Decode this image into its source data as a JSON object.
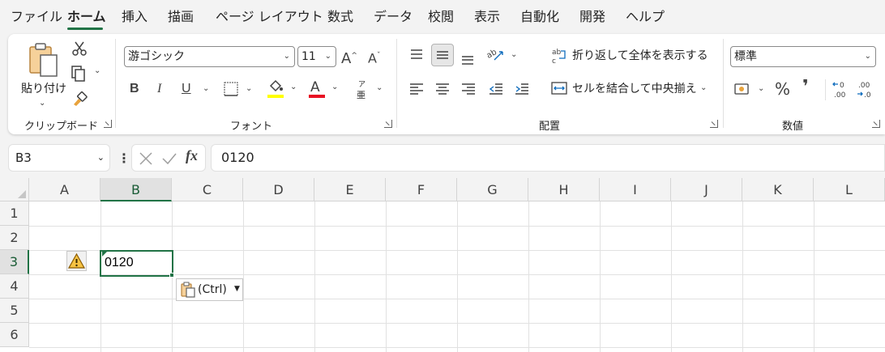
{
  "menu": {
    "tabs": [
      "ファイル",
      "ホーム",
      "挿入",
      "描画",
      "ページ レイアウト",
      "数式",
      "データ",
      "校閲",
      "表示",
      "自動化",
      "開発",
      "ヘルプ"
    ],
    "active_tab": "ホーム"
  },
  "ribbon": {
    "clipboard": {
      "paste_label": "貼り付け",
      "group_label": "クリップボード"
    },
    "font": {
      "font_name": "游ゴシック",
      "font_size": "11",
      "group_label": "フォント",
      "bold": "B",
      "italic": "I",
      "underline": "U",
      "phonetic_top": "ア",
      "phonetic_bottom": "亜"
    },
    "alignment": {
      "wrap_text": "折り返して全体を表示する",
      "merge_center": "セルを結合して中央揃え",
      "group_label": "配置"
    },
    "number": {
      "format": "標準",
      "percent": "%",
      "comma": "❜",
      "group_label": "数値"
    }
  },
  "formula_bar": {
    "name_box": "B3",
    "fx": "fx",
    "content": "0120"
  },
  "grid": {
    "columns": [
      "A",
      "B",
      "C",
      "D",
      "E",
      "F",
      "G",
      "H",
      "I",
      "J",
      "K",
      "L"
    ],
    "rows": [
      "1",
      "2",
      "3",
      "4",
      "5",
      "6"
    ],
    "selected_column": "B",
    "selected_row": "3",
    "cell_b3": "0120"
  },
  "paste_options": {
    "label": "(Ctrl)"
  },
  "colors": {
    "accent": "#217346",
    "highlight_yellow": "#ffff00",
    "font_red": "#ff0000"
  }
}
